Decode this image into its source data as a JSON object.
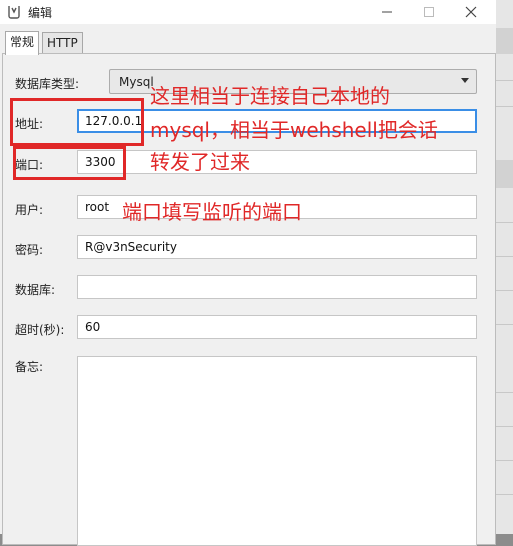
{
  "window": {
    "title": "编辑"
  },
  "tabs": [
    {
      "label": "常规"
    },
    {
      "label": "HTTP"
    }
  ],
  "form": {
    "db_type_label": "数据库类型:",
    "db_type_value": "Mysql",
    "address_label": "地址:",
    "address_value": "127.0.0.1",
    "port_label": "端口:",
    "port_value": "3300",
    "user_label": "用户:",
    "user_value": "root",
    "password_label": "密码:",
    "password_value": "R@v3nSecurity",
    "database_label": "数据库:",
    "database_value": "",
    "timeout_label": "超时(秒):",
    "timeout_value": "60",
    "notes_label": "备忘:",
    "notes_value": ""
  },
  "annotations": {
    "line1": "这里相当于连接自己本地的",
    "line2": "mysql，相当于wehshell把会话",
    "line3": "转发了过来",
    "port_note": "端口填写监听的端口"
  },
  "colors": {
    "annotation": "#e02828",
    "focus": "#3a8ee6",
    "window_bg": "#f0f0f0"
  }
}
